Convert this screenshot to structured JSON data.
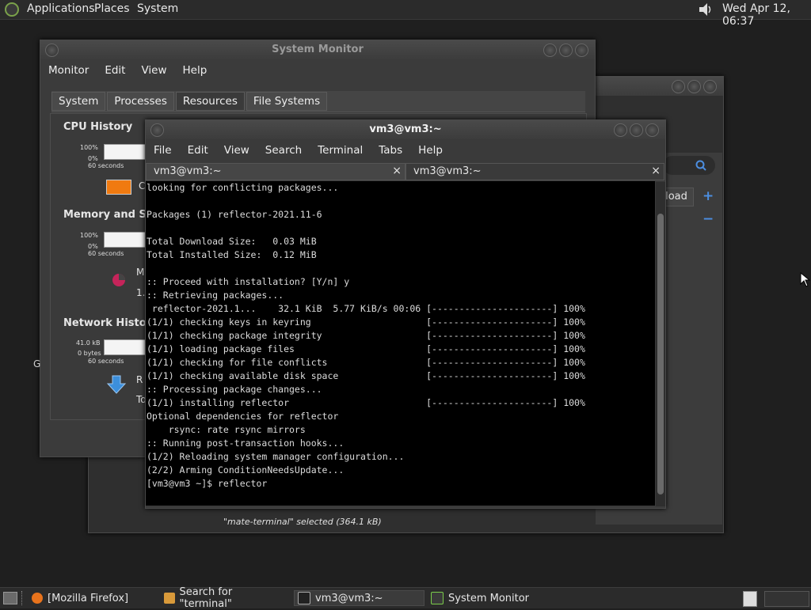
{
  "top_panel": {
    "menus": [
      "Applications",
      "Places",
      "System"
    ],
    "clock": "Wed Apr 12, 06:37"
  },
  "sysmon": {
    "title": "System Monitor",
    "menus": [
      "Monitor",
      "Edit",
      "View",
      "Help"
    ],
    "tabs": [
      "System",
      "Processes",
      "Resources",
      "File Systems"
    ],
    "selected_tab": "Resources",
    "cpu_title": "CPU History",
    "cpu_labels": [
      "100%",
      "0%",
      "60 seconds"
    ],
    "cpu_legend": "C",
    "mem_title": "Memory and Swa",
    "mem_labels": [
      "100%",
      "0%",
      "60 seconds"
    ],
    "mem_legend1": "M",
    "mem_legend2": "1.",
    "net_title": "Network History",
    "net_labels": [
      "41.0 kB",
      "0 bytes",
      "60 seconds"
    ],
    "net_legend1": "R",
    "net_legend2": "To",
    "side_letter": "G"
  },
  "back_window": {
    "reload_label": "eload",
    "plus": "+",
    "minus": "−",
    "status": "\"mate-terminal\" selected (364.1 kB)"
  },
  "terminal": {
    "title": "vm3@vm3:~",
    "menus": [
      "File",
      "Edit",
      "View",
      "Search",
      "Terminal",
      "Tabs",
      "Help"
    ],
    "tabs": [
      "vm3@vm3:~",
      "vm3@vm3:~"
    ],
    "output": "looking for conflicting packages...\n\nPackages (1) reflector-2021.11-6\n\nTotal Download Size:   0.03 MiB\nTotal Installed Size:  0.12 MiB\n\n:: Proceed with installation? [Y/n] y\n:: Retrieving packages...\n reflector-2021.1...    32.1 KiB  5.77 KiB/s 00:06 [----------------------] 100%\n(1/1) checking keys in keyring                     [----------------------] 100%\n(1/1) checking package integrity                   [----------------------] 100%\n(1/1) loading package files                        [----------------------] 100%\n(1/1) checking for file conflicts                  [----------------------] 100%\n(1/1) checking available disk space                [----------------------] 100%\n:: Processing package changes...\n(1/1) installing reflector                         [----------------------] 100%\nOptional dependencies for reflector\n    rsync: rate rsync mirrors\n:: Running post-transaction hooks...\n(1/2) Reloading system manager configuration...\n(2/2) Arming ConditionNeedsUpdate...\n[vm3@vm3 ~]$ reflector"
  },
  "taskbar": {
    "items": [
      "[Mozilla Firefox]",
      "Search for \"terminal\"",
      "vm3@vm3:~",
      "System Monitor"
    ],
    "active": "vm3@vm3:~"
  },
  "colors": {
    "cpu_legend": "#f07a10",
    "firefox": "#e8731c",
    "arrow": "#3c8fdc"
  }
}
